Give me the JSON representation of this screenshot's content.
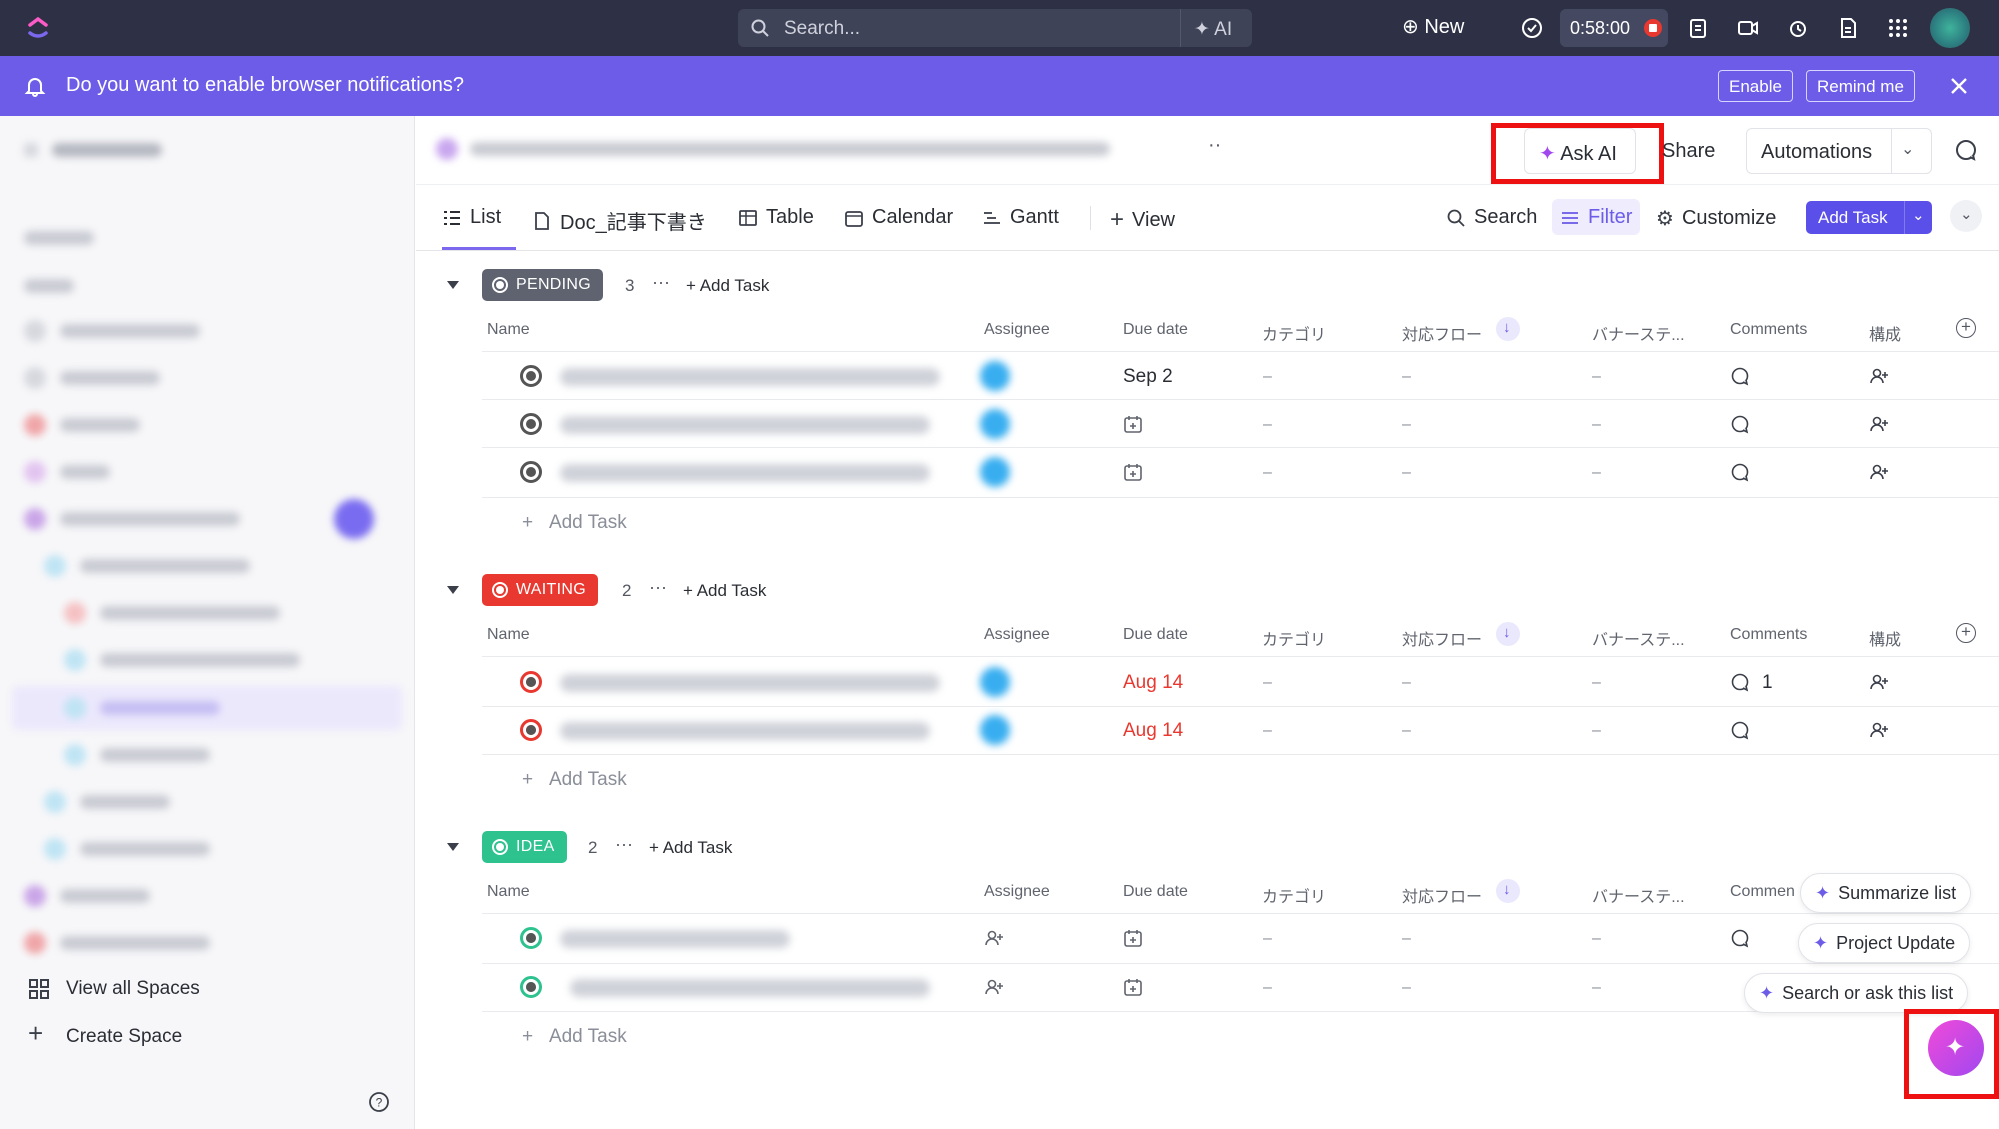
{
  "topbar": {
    "search_placeholder": "Search...",
    "ai_label": "AI",
    "new_label": "New",
    "timer": "0:58:00"
  },
  "banner": {
    "message": "Do you want to enable browser notifications?",
    "enable": "Enable",
    "remind": "Remind me"
  },
  "sidebar": {
    "view_all_spaces": "View all Spaces",
    "create_space": "Create Space"
  },
  "header": {
    "ask_ai": "Ask AI",
    "share": "Share",
    "automations": "Automations"
  },
  "tabs": {
    "list": "List",
    "doc": "Doc_記事下書き",
    "table": "Table",
    "calendar": "Calendar",
    "gantt": "Gantt",
    "view": "View"
  },
  "toolbar": {
    "search": "Search",
    "filter": "Filter",
    "customize": "Customize",
    "add_task": "Add Task"
  },
  "columns": {
    "name": "Name",
    "assignee": "Assignee",
    "due": "Due date",
    "category": "カテゴリ",
    "flow": "対応フロー",
    "banner_status": "バナーステ...",
    "comments": "Comments",
    "comments_short": "Commen",
    "composition": "構成"
  },
  "groups": [
    {
      "status": "PENDING",
      "count": "3",
      "add": "Add Task",
      "color": "#5f6370"
    },
    {
      "status": "WAITING",
      "count": "2",
      "add": "Add Task",
      "color": "#e8382f"
    },
    {
      "status": "IDEA",
      "count": "2",
      "add": "Add Task",
      "color": "#2ec28f"
    }
  ],
  "rows": {
    "pending_due_1": "Sep 2",
    "waiting_due_1": "Aug 14",
    "waiting_due_2": "Aug 14",
    "waiting_comment_count": "1",
    "dash": "–"
  },
  "add_task_row": "Add Task",
  "ai_suggestions": {
    "summarize": "Summarize list",
    "project_update": "Project Update",
    "search_ask": "Search or ask this list"
  }
}
